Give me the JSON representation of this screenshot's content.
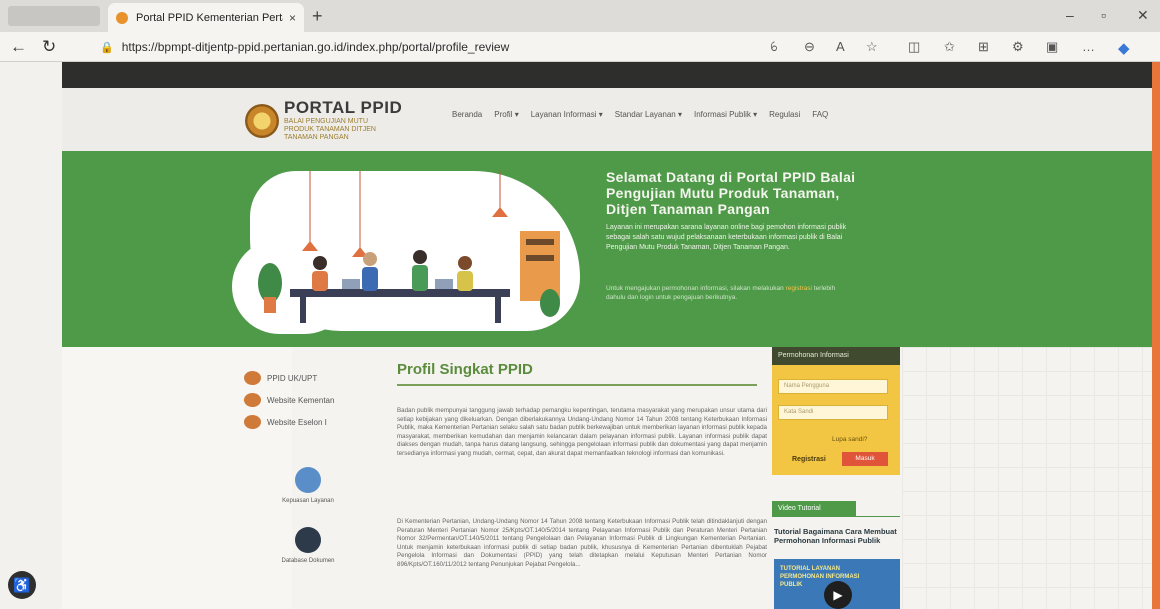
{
  "browser": {
    "tab_title": "Portal PPID Kementerian Pertani",
    "tab_close": "×",
    "new_tab": "+",
    "url": "https://bpmpt-ditjentp-ppid.pertanian.go.id/index.php/portal/profile_review",
    "icons": [
      "back-icon",
      "refresh-icon",
      "lock-icon",
      "read-aloud-icon",
      "zoom-icon",
      "font-icon",
      "favorite-icon",
      "split-screen-icon",
      "favorites-bar-icon",
      "collections-icon",
      "extensions-icon",
      "sidebar-icon",
      "more-icon",
      "edge-copilot-icon"
    ],
    "minimize": "–",
    "restore": "▫",
    "close": "✕"
  },
  "header": {
    "logo_title": "PORTAL PPID",
    "logo_subtitle": "BALAI PENGUJIAN MUTU PRODUK TANAMAN DITJEN TANAMAN PANGAN",
    "nav": [
      "Beranda",
      "Profil ▾",
      "Layanan Informasi ▾",
      "Standar Layanan ▾",
      "Informasi Publik ▾",
      "Regulasi",
      "FAQ"
    ]
  },
  "hero": {
    "title": "Selamat Datang di Portal PPID Balai Pengujian Mutu Produk Tanaman, Ditjen Tanaman Pangan",
    "description": "Layanan ini merupakan sarana layanan online bagi pemohon informasi publik sebagai salah satu wujud pelaksanaan keterbukaan informasi publik di Balai Pengujian Mutu Produk Tanaman, Ditjen Tanaman Pangan.",
    "note_prefix": "Untuk mengajukan permohonan informasi, silakan melakukan ",
    "note_highlight": "registrasi",
    "note_suffix": " terlebih dahulu dan login untuk pengajuan berikutnya."
  },
  "sidebar": {
    "links": [
      "PPID UK/UPT",
      "Website Kementan",
      "Website Eselon I"
    ],
    "services": [
      "Kepuasan Layanan",
      "Database Dokumen"
    ]
  },
  "profile": {
    "title": "Profil Singkat PPID",
    "para1": "Badan publik mempunyai tanggung jawab terhadap pemangku kepentingan, terutama masyarakat yang merupakan unsur utama dari setiap kebijakan yang dikeluarkan. Dengan diberlakukannya Undang-Undang Nomor 14 Tahun 2008 tentang Keterbukaan Informasi Publik, maka Kementerian Pertanian selaku salah satu badan publik berkewajiban untuk memberikan layanan informasi publik kepada masyarakat, memberikan kemudahan dan menjamin kelancaran dalam pelayanan informasi publik. Layanan informasi publik dapat diakses dengan mudah, tanpa harus datang langsung, sehingga pengelolaan informasi publik dan dokumentasi yang dapat menjamin tersedianya informasi yang mudah, cermat, cepat, dan akurat dapat memanfaatkan teknologi informasi dan komunikasi.",
    "para2": "Di Kementerian Pertanian, Undang-Undang Nomor 14 Tahun 2008 tentang Keterbukaan Informasi Publik telah ditindaklanjuti dengan Peraturan Menteri Pertanian Nomor 25/Kpts/OT.140/5/2014 tentang Pelayanan Informasi Publik dan Peraturan Menteri Pertanian Nomor 32/Permentan/OT.140/5/2011 tentang Pengelolaan dan Pelayanan Informasi Publik di Lingkungan Kementerian Pertanian. Untuk menjamin keterbukaan informasi publik di setiap badan publik, khususnya di Kementerian Pertanian dibentuklah Pejabat Pengelola Informasi dan Dokumentasi (PPID) yang telah ditetapkan melalui Keputusan Menteri Pertanian Nomor 896/Kpts/OT.160/11/2012 tentang Penunjukan Pejabat Pengelola..."
  },
  "request": {
    "header": "Permohonan Informasi",
    "name_placeholder": "Nama Pengguna",
    "password_placeholder": "Kata Sandi",
    "forgot": "Lupa sandi?",
    "register": "Registrasi",
    "login": "Masuk"
  },
  "video": {
    "tab": "Video Tutorial",
    "title": "Tutorial Bagaimana Cara Membuat Permohonan Informasi Publik",
    "thumb_text": "TUTORIAL LAYANAN PERMOHONAN INFORMASI PUBLIK"
  },
  "accessibility_icon": "♿",
  "colors": {
    "hero_green": "#4e9a48",
    "accent_orange": "#e8763a",
    "request_yellow": "#f2c542",
    "title_green": "#5b8c3c"
  }
}
